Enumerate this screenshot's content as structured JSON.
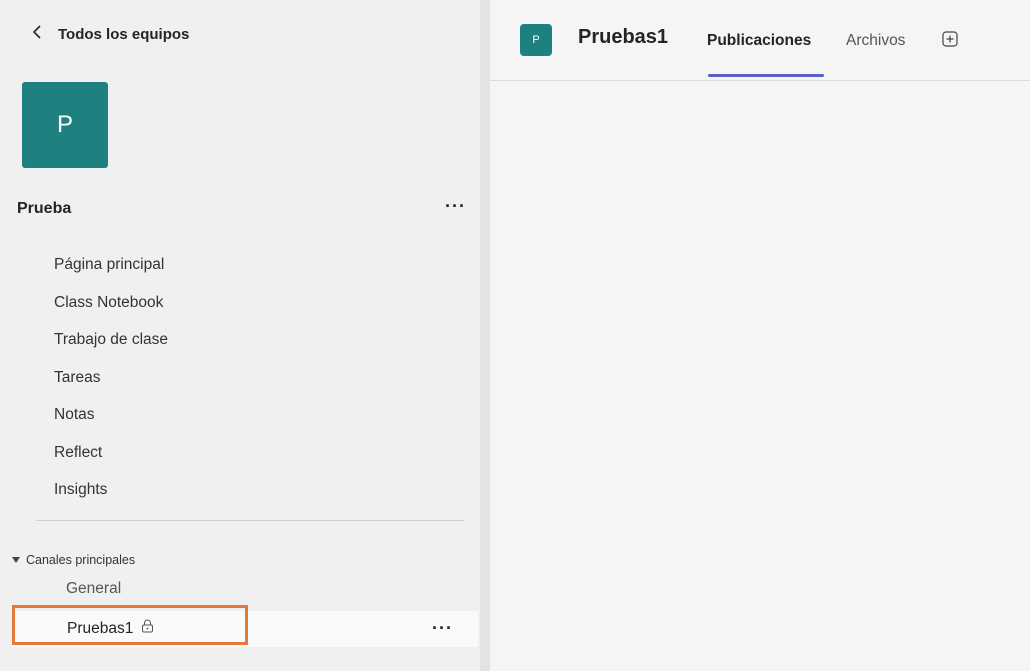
{
  "sidebar": {
    "back_label": "Todos los equipos",
    "team_initial": "P",
    "team_name": "Prueba",
    "more": "···",
    "nav": [
      "Página principal",
      "Class Notebook",
      "Trabajo de clase",
      "Tareas",
      "Notas",
      "Reflect",
      "Insights"
    ],
    "channels_header": "Canales principales",
    "channels": [
      {
        "label": "General"
      },
      {
        "label": "Pruebas1",
        "more": "···"
      }
    ]
  },
  "header": {
    "tile_initial": "P",
    "title": "Pruebas1",
    "tabs": [
      "Publicaciones",
      "Archivos"
    ]
  },
  "colors": {
    "team_tile": "#1f8080",
    "accent_tab": "#5b5fc7",
    "highlight_outline": "#e4793a"
  },
  "icons": {
    "back": "chevron-left-icon",
    "add_tab": "plus-square-icon",
    "channel_lock": "lock-icon",
    "collapse": "caret-down-icon"
  }
}
